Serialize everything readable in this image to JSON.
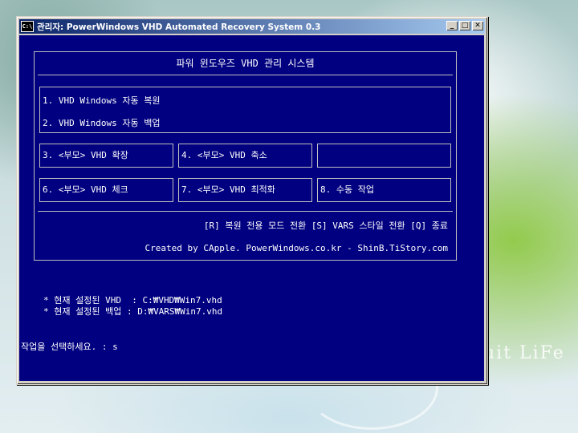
{
  "window": {
    "title": "관리자: PowerWindows VHD Automated Recovery System 0.3",
    "icon_text": "C:\\",
    "minimize": "_",
    "maximize": "□",
    "close": "✕"
  },
  "console": {
    "header": "파워 윈도우즈 VHD 관리 시스템",
    "menu": {
      "item1": "1. VHD Windows 자동 복원",
      "item2": "2. VHD Windows 자동 백업",
      "item3": "3. <부모> VHD 확장",
      "item4": "4. <부모> VHD 축소",
      "item5": "",
      "item6": "6. <부모> VHD 체크",
      "item7": "7. <부모> VHD 최적화",
      "item8": "8. 수동 작업"
    },
    "options": "[R] 복원 전용 모드 전환  [S] VARS 스타일 전환  [Q] 종료",
    "credits": "Created by CApple. PowerWindows.co.kr - ShinB.TiStory.com",
    "current_vhd": "* 현재 설정된 VHD  : C:₩VHD₩Win7.vhd",
    "current_backup": "* 현재 설정된 백업 : D:₩VARS₩Win7.vhd",
    "prompt": "작업을 선택하세요. : s"
  },
  "wallpaper": {
    "text": "uit LiFe"
  },
  "colors": {
    "console_bg": "#000080",
    "console_fg": "#ffffff",
    "title_start": "#0a246a",
    "title_end": "#a6caf0"
  }
}
